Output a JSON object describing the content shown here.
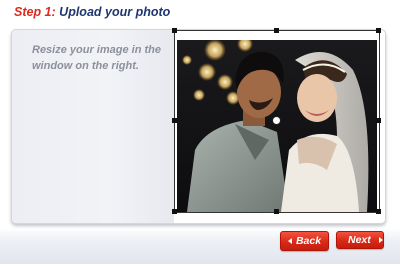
{
  "header": {
    "step_number": "Step 1:",
    "step_title": "Upload your photo",
    "colors": {
      "step_number": "#e02a1c",
      "step_title": "#1e3670"
    }
  },
  "panel": {
    "instructions": "Resize your image in the window on the right.",
    "photo": {
      "description_icon": "photo-image",
      "crop_handles": 8,
      "has_center_handle": true
    }
  },
  "buttons": {
    "back_label": "Back",
    "next_label": "Next",
    "back_icon": "triangle-left-icon",
    "next_icon": "triangle-right-icon",
    "color": "#d82a17"
  }
}
